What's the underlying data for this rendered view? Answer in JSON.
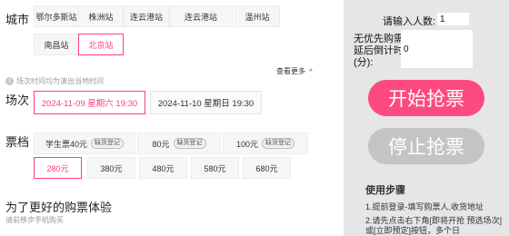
{
  "left": {
    "city_label": "城市",
    "cities": [
      {
        "name": "鄂尔多斯站",
        "active": false
      },
      {
        "name": "株洲站",
        "active": false
      },
      {
        "name": "连云港站",
        "active": false
      },
      {
        "name": "连云港站",
        "active": false
      },
      {
        "name": "温州站",
        "active": false
      },
      {
        "name": "南昌站",
        "active": false
      },
      {
        "name": "北京站",
        "active": true
      }
    ],
    "hint": "场次时间均为演出当地时间",
    "more": "查看更多",
    "session_label": "场次",
    "sessions": [
      {
        "text": "2024-11-09 星期六 19:30",
        "active": true
      },
      {
        "text": "2024-11-10 星期日 19:30",
        "active": false
      }
    ],
    "ticket_label": "票档",
    "tickets_row1": [
      {
        "price": "学生票40元",
        "tag": "缺货登记"
      },
      {
        "price": "80元",
        "tag": "缺货登记"
      },
      {
        "price": "100元",
        "tag": "缺货登记"
      }
    ],
    "tickets_row2": [
      {
        "price": "280元",
        "active": true
      },
      {
        "price": "380元",
        "active": false
      },
      {
        "price": "480元",
        "active": false
      },
      {
        "price": "580元",
        "active": false
      },
      {
        "price": "680元",
        "active": false
      }
    ],
    "promo_title": "为了更好的购票体验",
    "promo_sub": "请前移步手机购买"
  },
  "panel": {
    "count_label": "请输入人数:",
    "count_value": "1",
    "delay_label_1": "无优先购需",
    "delay_label_2": "延后倒计时",
    "delay_label_3": "(分):",
    "delay_value": "0",
    "start_label": "开始抢票",
    "stop_label": "停止抢票",
    "steps_title": "使用步骤",
    "step1": "1.提前登录-填写购票人,收货地址",
    "step2": "2.请先点击右下角[即将开抢 预选场次]或[立即预定]按钮，多个日"
  },
  "colors": {
    "accent": "#ff3d7f",
    "start_button": "#fc4a80",
    "stop_button": "#c4c4c4",
    "panel_bg": "#e6e6e6"
  }
}
